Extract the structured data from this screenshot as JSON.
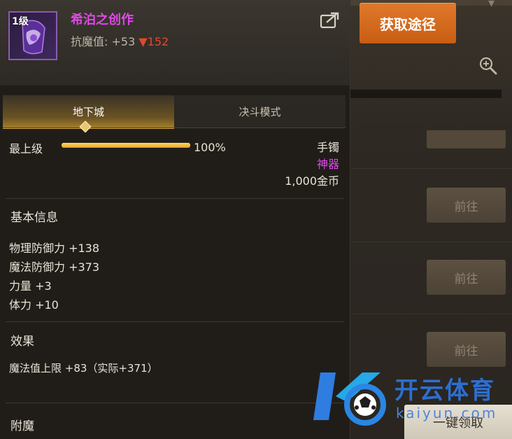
{
  "item": {
    "level_tag": "1级",
    "name": "希泊之创作",
    "resist_label": "抗魔值:",
    "resist_value": "+53",
    "resist_down": "▼152"
  },
  "tabs": [
    {
      "label": "地下城",
      "active": true
    },
    {
      "label": "决斗模式",
      "active": false
    }
  ],
  "progress": {
    "label": "最上级",
    "percent_text": "100%",
    "fraction": 1.0
  },
  "item_meta": {
    "type": "手镯",
    "rarity": "神器",
    "price": "1,000金币"
  },
  "sections": {
    "basic_info": "基本信息",
    "effects": "效果",
    "enchant": "附魔"
  },
  "stats": [
    "物理防御力 +138",
    "魔法防御力 +373",
    "力量 +3",
    "体力 +10"
  ],
  "effects": [
    "魔法值上限 +83（实际+371）"
  ],
  "side": {
    "acquire_label": "获取途径",
    "goto_labels": [
      "前往",
      "前往",
      "前往"
    ],
    "onekey_label": "一键领取"
  },
  "watermark": {
    "brand": "开云体育",
    "url": "kaiyun.com"
  },
  "colors": {
    "item_name": "#e048e8",
    "rarity": "#e048e8",
    "resist_down": "#e0492e",
    "acquire_button": "#d96c1e",
    "progress_fill": "#f0bd3c"
  },
  "icons": {
    "share": "share-icon",
    "zoom": "zoom-in-icon",
    "item": "bracelet-icon"
  }
}
